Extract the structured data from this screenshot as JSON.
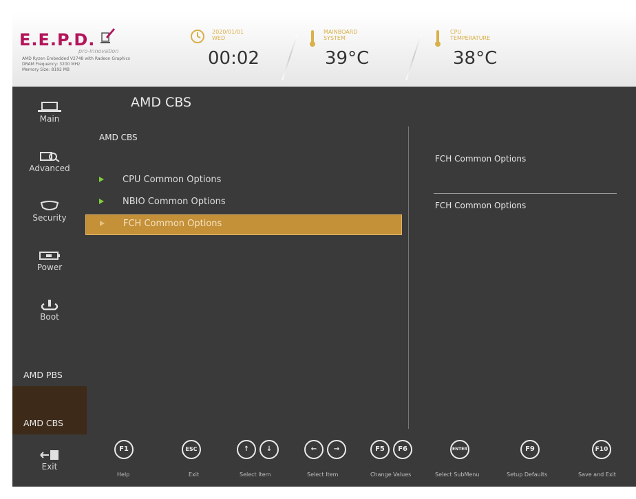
{
  "header": {
    "logo_text": "E.E.P.D.",
    "logo_sub": "pro-innovation",
    "sysinfo": [
      "AMD Ryzen Embedded V2748 with Radeon Graphics",
      "DRAM Frequency: 3200 MHz",
      "Memory Size: 8192 MB"
    ],
    "clock": {
      "label_line1": "2020/01/01",
      "label_line2": "WED",
      "value": "00:02"
    },
    "mainboard": {
      "label_line1": "MAINBOARD",
      "label_line2": "SYSTEM",
      "value": "39°C"
    },
    "cpu": {
      "label_line1": "CPU",
      "label_line2": "TEMPERATURE",
      "value": "38°C"
    },
    "accent_color": "#d9b04a",
    "brand_color": "#b4145a"
  },
  "sidebar": {
    "items": [
      {
        "label": "Main",
        "icon": "monitor-icon"
      },
      {
        "label": "Advanced",
        "icon": "magnifier-icon"
      },
      {
        "label": "Security",
        "icon": "shield-icon"
      },
      {
        "label": "Power",
        "icon": "battery-icon"
      },
      {
        "label": "Boot",
        "icon": "power-icon"
      },
      {
        "label": "AMD PBS"
      },
      {
        "label": "AMD CBS",
        "selected": true
      },
      {
        "label": "Exit",
        "icon": "exit-door-icon"
      }
    ],
    "selected_bg": "#3d2a18"
  },
  "main": {
    "title": "AMD CBS",
    "section_heading": "AMD CBS",
    "items": [
      {
        "label": "CPU Common Options"
      },
      {
        "label": "NBIO Common Options"
      },
      {
        "label": "FCH Common Options",
        "selected": true
      }
    ],
    "arrow_color": "#7fd03a",
    "selected_color": "#c49038"
  },
  "help": {
    "title": "FCH Common Options",
    "description": "FCH Common Options"
  },
  "footer": {
    "keys": [
      {
        "keys": [
          "F1"
        ],
        "label": "Help"
      },
      {
        "keys": [
          "ESC"
        ],
        "label": "Exit"
      },
      {
        "keys": [
          "↑",
          "↓"
        ],
        "label": "Select Item"
      },
      {
        "keys": [
          "←",
          "→"
        ],
        "label": "Select Item"
      },
      {
        "keys": [
          "F5",
          "F6"
        ],
        "label": "Change Values"
      },
      {
        "keys": [
          "ENTER"
        ],
        "label": "Select SubMenu"
      },
      {
        "keys": [
          "F9"
        ],
        "label": "Setup Defaults"
      },
      {
        "keys": [
          "F10"
        ],
        "label": "Save and Exit"
      }
    ]
  }
}
